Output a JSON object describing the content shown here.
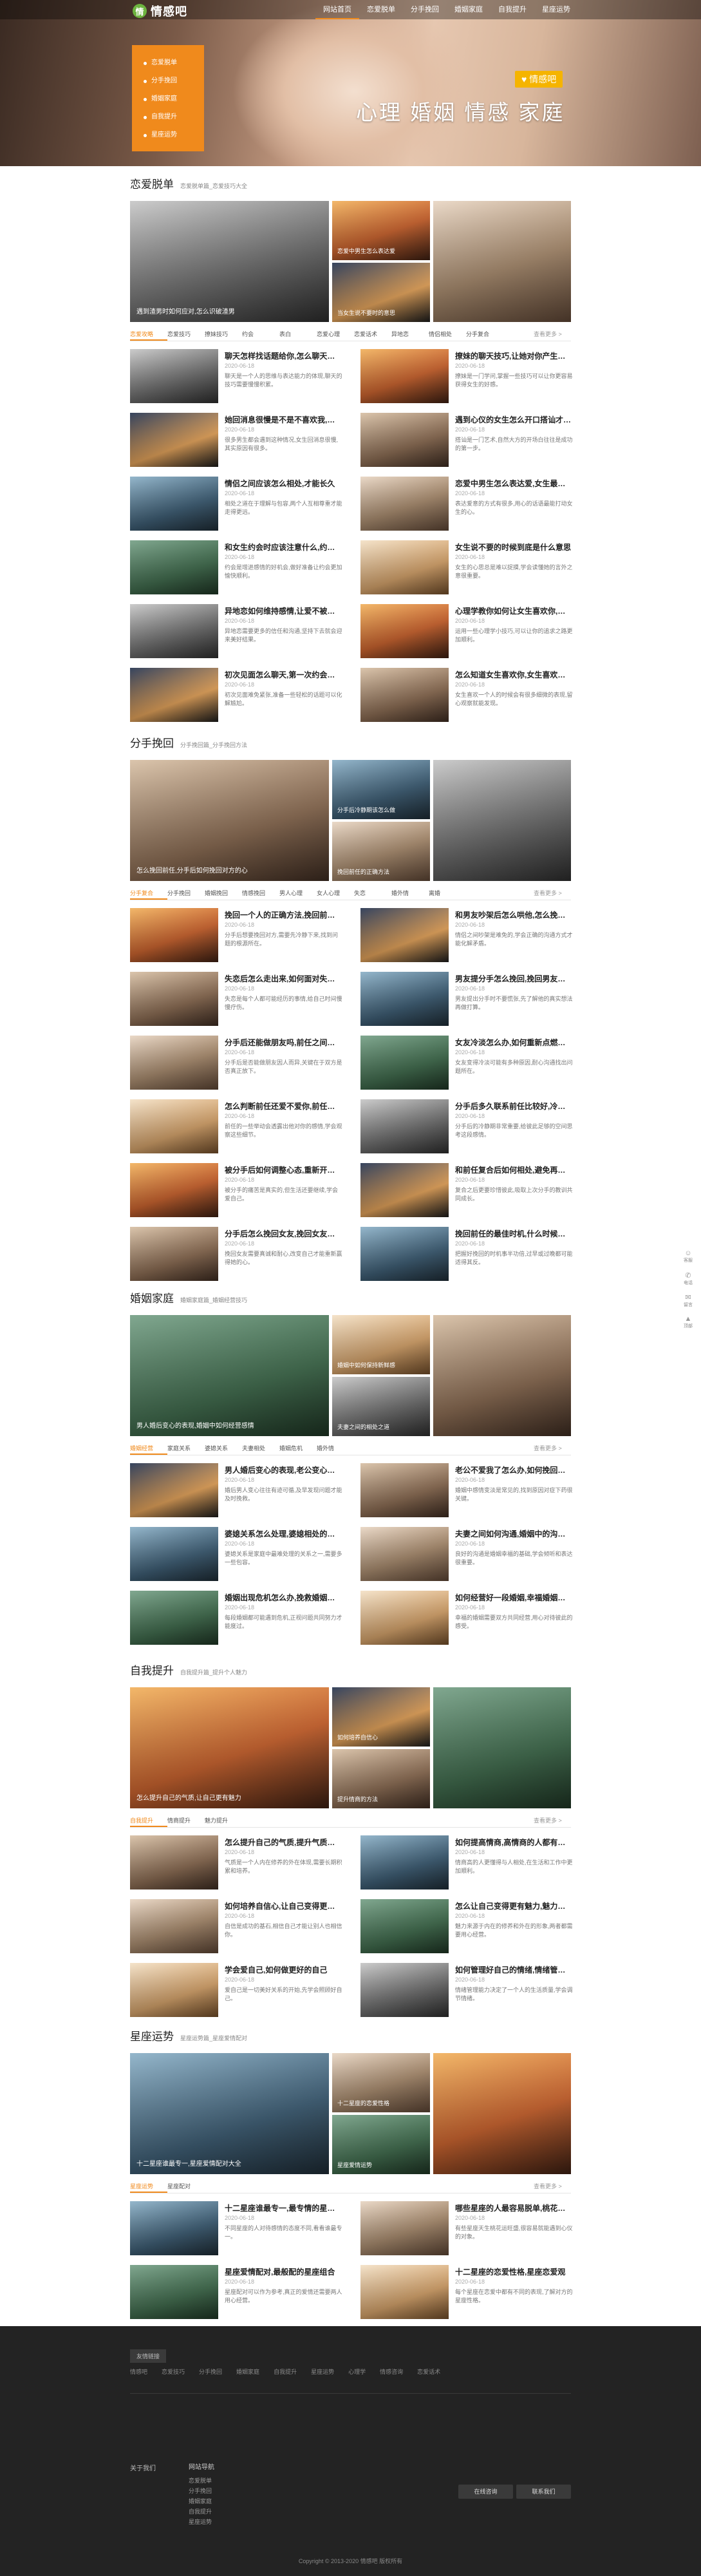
{
  "site": {
    "logo_text": "情感吧",
    "logo_mark": "情"
  },
  "nav": [
    "网站首页",
    "恋爱脱单",
    "分手挽回",
    "婚姻家庭",
    "自我提升",
    "星座运势"
  ],
  "side_menu": [
    "恋爱脱单",
    "分手挽回",
    "婚姻家庭",
    "自我提升",
    "星座运势"
  ],
  "hero": {
    "tag": "♥ 情感吧",
    "title": "心理 婚姻 情感 家庭"
  },
  "sections": [
    {
      "title": "恋爱脱单",
      "sub": "恋爱脱单篇_恋爱技巧大全",
      "feature": {
        "big": "遇到渣男时如何应对,怎么识破渣男",
        "s1": "恋爱中男生怎么表达爱",
        "s2": "当女生说不要时的意思"
      },
      "tabs": [
        "恋爱攻略",
        "恋爱技巧",
        "撩妹技巧",
        "约会",
        "表白",
        "恋爱心理",
        "恋爱话术",
        "异地恋",
        "情侣相处",
        "分手复合"
      ],
      "more": "查看更多 >",
      "items": [
        {
          "t": "聊天怎样找话题给你,怎么聊天不冷场",
          "d": "2020-06-18",
          "s": "聊天是一个人的思维与表达能力的体现,聊天的技巧需要慢慢积累。"
        },
        {
          "t": "撩妹的聊天技巧,让她对你产生好感",
          "d": "2020-06-18",
          "s": "撩妹是一门学问,掌握一些技巧可以让你更容易获得女生的好感。"
        },
        {
          "t": "她回消息很慢是不是不喜欢我,怎么判断",
          "d": "2020-06-18",
          "s": "很多男生都会遇到这种情况,女生回消息很慢,其实原因有很多。"
        },
        {
          "t": "遇到心仪的女生怎么开口搭讪才不尴尬",
          "d": "2020-06-18",
          "s": "搭讪是一门艺术,自然大方的开场白往往是成功的第一步。"
        },
        {
          "t": "情侣之间应该怎么相处,才能长久",
          "d": "2020-06-18",
          "s": "相处之道在于理解与包容,两个人互相尊重才能走得更远。"
        },
        {
          "t": "恋爱中男生怎么表达爱,女生最想听的话",
          "d": "2020-06-18",
          "s": "表达爱意的方式有很多,用心的话语最能打动女生的心。"
        },
        {
          "t": "和女生约会时应该注意什么,约会技巧",
          "d": "2020-06-18",
          "s": "约会是增进感情的好机会,做好准备让约会更加愉快顺利。"
        },
        {
          "t": "女生说不要的时候到底是什么意思",
          "d": "2020-06-18",
          "s": "女生的心思总是难以捉摸,学会读懂她的言外之意很重要。"
        },
        {
          "t": "异地恋如何维持感情,让爱不被距离打败",
          "d": "2020-06-18",
          "s": "异地恋需要更多的信任和沟通,坚持下去就会迎来美好结果。"
        },
        {
          "t": "心理学教你如何让女生喜欢你,追女生技巧",
          "d": "2020-06-18",
          "s": "运用一些心理学小技巧,可以让你的追求之路更加顺利。"
        },
        {
          "t": "初次见面怎么聊天,第一次约会聊什么",
          "d": "2020-06-18",
          "s": "初次见面难免紧张,准备一些轻松的话题可以化解尴尬。"
        },
        {
          "t": "怎么知道女生喜欢你,女生喜欢你的表现",
          "d": "2020-06-18",
          "s": "女生喜欢一个人的时候会有很多细微的表现,留心观察就能发现。"
        }
      ]
    },
    {
      "title": "分手挽回",
      "sub": "分手挽回篇_分手挽回方法",
      "feature": {
        "big": "怎么挽回前任,分手后如何挽回对方的心",
        "s1": "分手后冷静期该怎么做",
        "s2": "挽回前任的正确方法"
      },
      "tabs": [
        "分手复合",
        "分手挽回",
        "婚姻挽回",
        "情感挽回",
        "男人心理",
        "女人心理",
        "失恋",
        "婚外情",
        "离婚"
      ],
      "more": "查看更多 >",
      "items": [
        {
          "t": "挽回一个人的正确方法,挽回前任的步骤",
          "d": "2020-06-18",
          "s": "分手后想要挽回对方,需要先冷静下来,找到问题的根源所在。"
        },
        {
          "t": "和男友吵架后怎么哄他,怎么挽回男友",
          "d": "2020-06-18",
          "s": "情侣之间吵架是难免的,学会正确的沟通方式才能化解矛盾。"
        },
        {
          "t": "失恋后怎么走出来,如何面对失恋的痛苦",
          "d": "2020-06-18",
          "s": "失恋是每个人都可能经历的事情,给自己时间慢慢疗伤。"
        },
        {
          "t": "男友提分手怎么挽回,挽回男友的方法",
          "d": "2020-06-18",
          "s": "男友提出分手时不要慌张,先了解他的真实想法再做打算。"
        },
        {
          "t": "分手后还能做朋友吗,前任之间的相处",
          "d": "2020-06-18",
          "s": "分手后是否能做朋友因人而异,关键在于双方是否真正放下。"
        },
        {
          "t": "女友冷淡怎么办,如何重新点燃她的热情",
          "d": "2020-06-18",
          "s": "女友变得冷淡可能有多种原因,耐心沟通找出问题所在。"
        },
        {
          "t": "怎么判断前任还爱不爱你,前任的表现",
          "d": "2020-06-18",
          "s": "前任的一些举动会透露出他对你的感情,学会观察这些细节。"
        },
        {
          "t": "分手后多久联系前任比较好,冷静期多久",
          "d": "2020-06-18",
          "s": "分手后的冷静期非常重要,给彼此足够的空间思考这段感情。"
        },
        {
          "t": "被分手后如何调整心态,重新开始生活",
          "d": "2020-06-18",
          "s": "被分手的痛苦是真实的,但生活还要继续,学会爱自己。"
        },
        {
          "t": "和前任复合后如何相处,避免再次分手",
          "d": "2020-06-18",
          "s": "复合之后更要珍惜彼此,吸取上次分手的教训共同成长。"
        },
        {
          "t": "分手后怎么挽回女友,挽回女友的技巧",
          "d": "2020-06-18",
          "s": "挽回女友需要真诚和耐心,改变自己才能重新赢得她的心。"
        },
        {
          "t": "挽回前任的最佳时机,什么时候挽回最好",
          "d": "2020-06-18",
          "s": "把握好挽回的时机事半功倍,过早或过晚都可能适得其反。"
        }
      ]
    },
    {
      "title": "婚姻家庭",
      "sub": "婚姻家庭篇_婚姻经营技巧",
      "feature": {
        "big": "男人婚后变心的表现,婚姻中如何经营感情",
        "s1": "婚姻中如何保持新鲜感",
        "s2": "夫妻之间的相处之道"
      },
      "tabs": [
        "婚姻经营",
        "家庭关系",
        "婆媳关系",
        "夫妻相处",
        "婚姻危机",
        "婚外情"
      ],
      "more": "查看更多 >",
      "items": [
        {
          "t": "男人婚后变心的表现,老公变心了怎么办",
          "d": "2020-06-18",
          "s": "婚后男人变心往往有迹可循,及早发现问题才能及时挽救。"
        },
        {
          "t": "老公不爱我了怎么办,如何挽回老公的心",
          "d": "2020-06-18",
          "s": "婚姻中感情变淡是常见的,找到原因对症下药很关键。"
        },
        {
          "t": "婆媳关系怎么处理,婆媳相处的技巧",
          "d": "2020-06-18",
          "s": "婆媳关系是家庭中最难处理的关系之一,需要多一些包容。"
        },
        {
          "t": "夫妻之间如何沟通,婚姻中的沟通技巧",
          "d": "2020-06-18",
          "s": "良好的沟通是婚姻幸福的基础,学会倾听和表达很重要。"
        },
        {
          "t": "婚姻出现危机怎么办,挽救婚姻的方法",
          "d": "2020-06-18",
          "s": "每段婚姻都可能遇到危机,正视问题共同努力才能度过。"
        },
        {
          "t": "如何经营好一段婚姻,幸福婚姻的秘诀",
          "d": "2020-06-18",
          "s": "幸福的婚姻需要双方共同经营,用心对待彼此的感受。"
        }
      ]
    },
    {
      "title": "自我提升",
      "sub": "自我提升篇_提升个人魅力",
      "feature": {
        "big": "怎么提升自己的气质,让自己更有魅力",
        "s1": "如何培养自信心",
        "s2": "提升情商的方法"
      },
      "tabs": [
        "自我提升",
        "情商提升",
        "魅力提升"
      ],
      "more": "查看更多 >",
      "items": [
        {
          "t": "怎么提升自己的气质,提升气质的方法",
          "d": "2020-06-18",
          "s": "气质是一个人内在修养的外在体现,需要长期积累和培养。"
        },
        {
          "t": "如何提高情商,高情商的人都有哪些特点",
          "d": "2020-06-18",
          "s": "情商高的人更懂得与人相处,在生活和工作中更加顺利。"
        },
        {
          "t": "如何培养自信心,让自己变得更加自信",
          "d": "2020-06-18",
          "s": "自信是成功的基石,相信自己才能让别人也相信你。"
        },
        {
          "t": "怎么让自己变得更有魅力,魅力提升技巧",
          "d": "2020-06-18",
          "s": "魅力来源于内在的修养和外在的形象,两者都需要用心经营。"
        },
        {
          "t": "学会爱自己,如何做更好的自己",
          "d": "2020-06-18",
          "s": "爱自己是一切美好关系的开始,先学会照顾好自己。"
        },
        {
          "t": "如何管理好自己的情绪,情绪管理方法",
          "d": "2020-06-18",
          "s": "情绪管理能力决定了一个人的生活质量,学会调节情绪。"
        }
      ]
    },
    {
      "title": "星座运势",
      "sub": "星座运势篇_星座爱情配对",
      "feature": {
        "big": "十二星座谁最专一,星座爱情配对大全",
        "s1": "十二星座的恋爱性格",
        "s2": "星座爱情运势"
      },
      "tabs": [
        "星座运势",
        "星座配对"
      ],
      "more": "查看更多 >",
      "items": [
        {
          "t": "十二星座谁最专一,最专情的星座排行",
          "d": "2020-06-18",
          "s": "不同星座的人对待感情的态度不同,看看谁最专一。"
        },
        {
          "t": "哪些星座的人最容易脱单,桃花运最旺",
          "d": "2020-06-18",
          "s": "有些星座天生桃花运旺盛,很容易就能遇到心仪的对象。"
        },
        {
          "t": "星座爱情配对,最般配的星座组合",
          "d": "2020-06-18",
          "s": "星座配对可以作为参考,真正的爱情还需要两人用心经营。"
        },
        {
          "t": "十二星座的恋爱性格,星座恋爱观",
          "d": "2020-06-18",
          "s": "每个星座在恋爱中都有不同的表现,了解对方的星座性格。"
        },
        {
          "t": "星座爱情运势,哪些星座本月会遇到真爱",
          "d": "2020-06-18",
          "s": "本月爱情运势解读,看看你的星座能否遇到真爱。"
        },
        {
          "t": "最容易被伤害的星座,感情中太过付出",
          "d": "2020-06-18",
          "s": "有些星座在感情中总是付出太多,反而容易受到伤害。"
        }
      ]
    }
  ],
  "footer": {
    "links_title": "友情链接",
    "links": [
      "情感吧",
      "恋爱技巧",
      "分手挽回",
      "婚姻家庭",
      "自我提升",
      "星座运势",
      "心理学",
      "情感咨询",
      "恋爱话术"
    ],
    "about": "关于我们",
    "col_title": "网站导航",
    "col_items": [
      "恋爱脱单",
      "分手挽回",
      "婚姻家庭",
      "自我提升",
      "星座运势"
    ],
    "btn1": "在线咨询",
    "btn2": "联系我们",
    "copyright": "Copyright © 2013-2020 情感吧 版权所有"
  },
  "float": [
    {
      "icon": "☺",
      "label": "客服"
    },
    {
      "icon": "✆",
      "label": "电话"
    },
    {
      "icon": "✉",
      "label": "留言"
    },
    {
      "icon": "▲",
      "label": "顶部"
    }
  ],
  "colors": {
    "accent": "#f08a1c",
    "footer": "#232323"
  }
}
